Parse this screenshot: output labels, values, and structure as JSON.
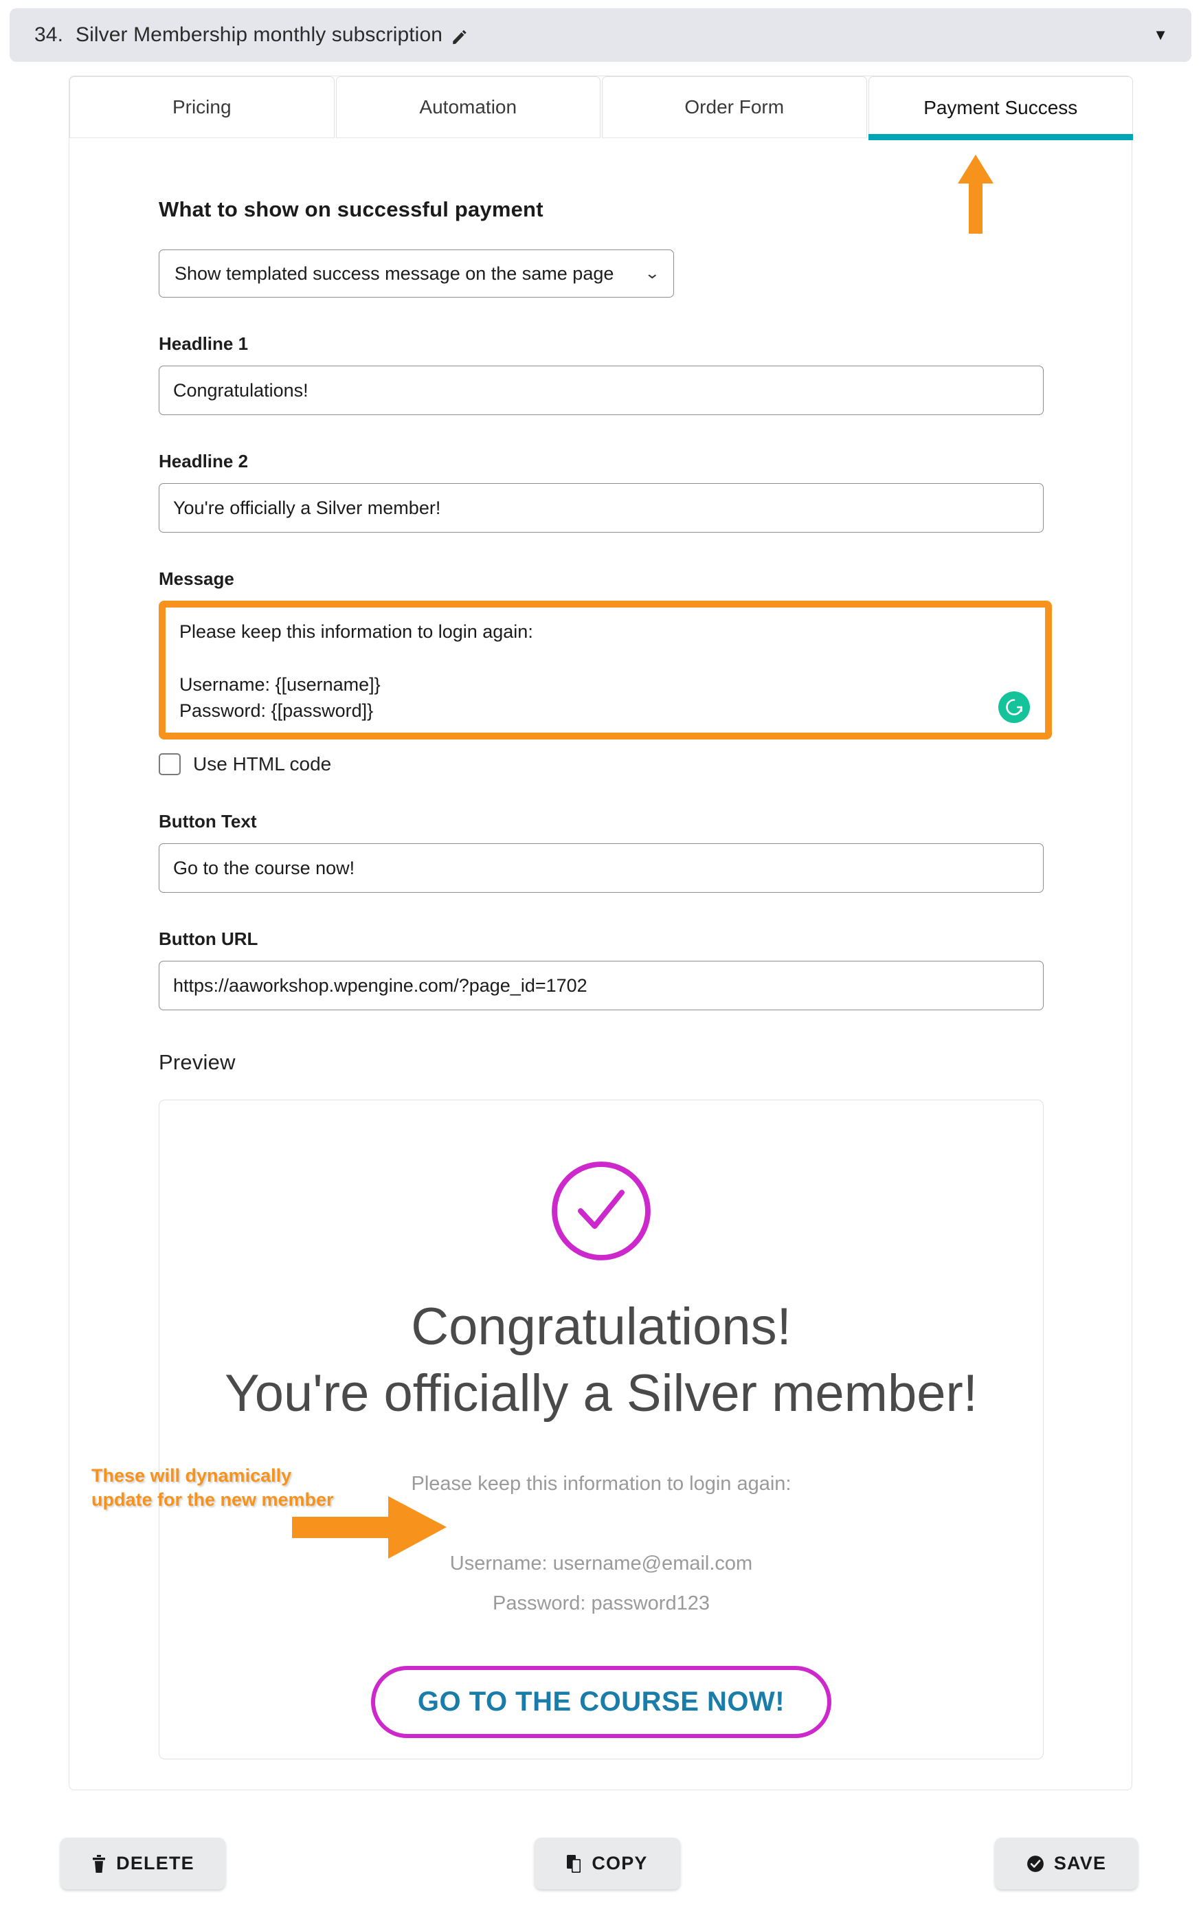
{
  "accordion": {
    "number": "34.",
    "title": "Silver Membership monthly subscription",
    "edit_icon": "pencil-icon",
    "collapse_icon": "chevron-down-icon"
  },
  "tabs": [
    {
      "label": "Pricing",
      "active": false
    },
    {
      "label": "Automation",
      "active": false
    },
    {
      "label": "Order Form",
      "active": false
    },
    {
      "label": "Payment Success",
      "active": true
    }
  ],
  "form": {
    "section_title": "What to show on successful payment",
    "behavior_select": {
      "value": "Show templated success message on the same page",
      "caret_icon": "chevron-down-icon"
    },
    "headline1": {
      "label": "Headline 1",
      "value": "Congratulations!"
    },
    "headline2": {
      "label": "Headline 2",
      "value": "You're officially a Silver member!"
    },
    "message": {
      "label": "Message",
      "value": "Please keep this information to login again:\n\nUsername: {[username]}\nPassword: {[password]}",
      "assistant_icon": "grammarly-icon",
      "highlight_color": "#f7931d"
    },
    "use_html": {
      "label": "Use HTML code",
      "checked": false
    },
    "button_text": {
      "label": "Button Text",
      "value": "Go to the course now!"
    },
    "button_url": {
      "label": "Button URL",
      "value": "https://aaworkshop.wpengine.com/?page_id=1702"
    }
  },
  "preview": {
    "title": "Preview",
    "check_icon": "check-circle-icon",
    "headline1": "Congratulations!",
    "headline2": "You're officially a Silver member!",
    "message": "Please keep this information to login again:\n\nUsername: username@email.com\nPassword: password123",
    "button_label": "GO TO THE COURSE NOW!",
    "accent_color": "#cc28cc",
    "button_text_color": "#1a7ca8"
  },
  "annotations": {
    "dynamic_note": "These will dynamically update for the new member",
    "arrow_color": "#f7931d",
    "tab_arrow_icon": "arrow-up-icon",
    "field_arrow_icon": "arrow-right-icon"
  },
  "footer": {
    "delete": {
      "label": "DELETE",
      "icon": "trash-icon"
    },
    "copy": {
      "label": "COPY",
      "icon": "copy-icon"
    },
    "save": {
      "label": "SAVE",
      "icon": "check-badge-icon"
    }
  },
  "colors": {
    "active_tab_underline": "#00a5b5",
    "highlight_orange": "#f7931d",
    "preview_magenta": "#cc28cc",
    "grammarly_green": "#15c39a",
    "header_bar": "#e4e6eb"
  }
}
